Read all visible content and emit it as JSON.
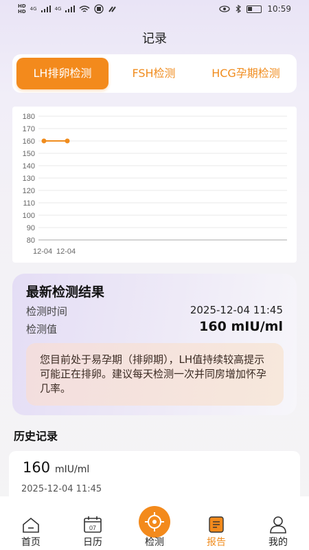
{
  "status_bar": {
    "left_hd_top": "HD",
    "left_hd_bottom": "HD",
    "net1": "4G",
    "net2": "4G",
    "time": "10:59"
  },
  "header": {
    "title": "记录"
  },
  "tabs": [
    {
      "label": "LH排卵检测",
      "active": true
    },
    {
      "label": "FSH检测",
      "active": false
    },
    {
      "label": "HCG孕期检测",
      "active": false
    }
  ],
  "chart_data": {
    "type": "line",
    "title": "",
    "xlabel": "",
    "ylabel": "",
    "x": [
      "12-04",
      "12-04"
    ],
    "series": [
      {
        "values": [
          160,
          160
        ]
      }
    ],
    "ylim": [
      80,
      180
    ],
    "yticks": [
      180,
      170,
      160,
      150,
      140,
      130,
      120,
      110,
      100,
      90,
      80
    ],
    "grid": true,
    "line_color": "#f08c1e"
  },
  "latest": {
    "title": "最新检测结果",
    "time_label": "检测时间",
    "time_value": "2025-12-04 11:45",
    "value_label": "检测值",
    "value": "160 mIU/ml",
    "advice": "您目前处于易孕期（排卵期），LH值持续较高提示可能正在排卵。建议每天检测一次并同房增加怀孕几率。"
  },
  "history": {
    "title": "历史记录",
    "items": [
      {
        "value": "160",
        "unit": "mIU/ml",
        "time": "2025-12-04 11:45"
      }
    ]
  },
  "bottom_nav": [
    {
      "label": "首页",
      "icon": "home-icon"
    },
    {
      "label": "日历",
      "icon": "calendar-icon",
      "icon_text": "07"
    },
    {
      "label": "检测",
      "icon": "scan-icon"
    },
    {
      "label": "报告",
      "icon": "report-icon",
      "active": true
    },
    {
      "label": "我的",
      "icon": "profile-icon"
    }
  ],
  "colors": {
    "accent": "#f38a1c",
    "accent_text": "#f08c1e"
  }
}
